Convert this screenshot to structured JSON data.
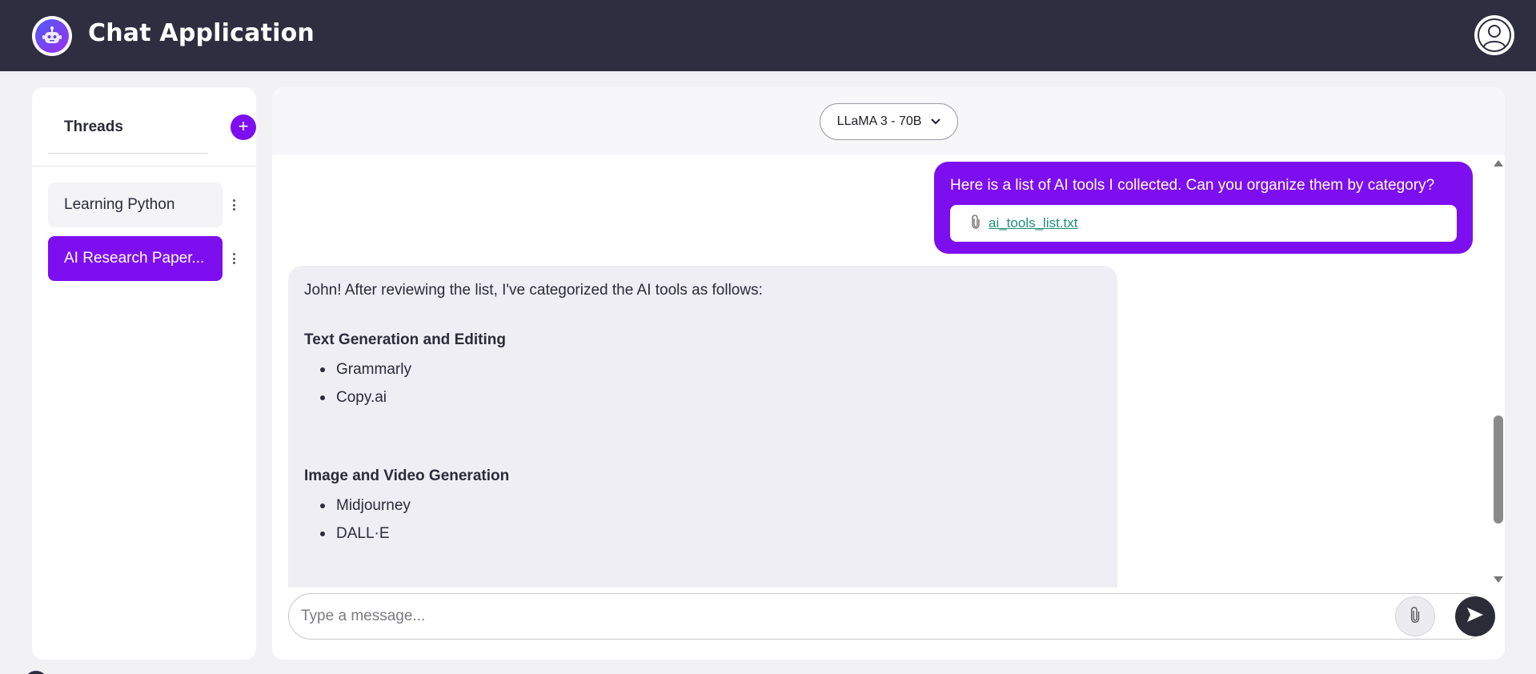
{
  "header": {
    "app_title": "Chat Application",
    "logo_icon": "robot-icon",
    "user_icon": "user-profile-icon"
  },
  "sidebar": {
    "title": "Threads",
    "add_label": "+",
    "threads": [
      {
        "label": "Learning Python",
        "active": false
      },
      {
        "label": "AI Research Paper...",
        "active": true
      }
    ]
  },
  "model_selector": {
    "selected": "LLaMA 3 - 70B"
  },
  "messages": {
    "user": {
      "text": "Here is a list of AI tools I collected. Can you organize them by category?",
      "attachment_name": "ai_tools_list.txt"
    },
    "assistant": {
      "intro": "John! After reviewing the list, I've categorized the AI tools as follows:",
      "sections": [
        {
          "heading": "Text Generation and Editing",
          "items": [
            "Grammarly",
            "Copy.ai"
          ]
        },
        {
          "heading": "Image and Video Generation",
          "items": [
            "Midjourney",
            "DALL·E"
          ]
        }
      ]
    }
  },
  "composer": {
    "placeholder": "Type a message..."
  },
  "colors": {
    "header_bg": "#2f2d40",
    "accent": "#7d0ef0",
    "assistant_bubble": "#efeef4",
    "attachment_link": "#1f8f79",
    "send_button": "#2c2c38"
  }
}
